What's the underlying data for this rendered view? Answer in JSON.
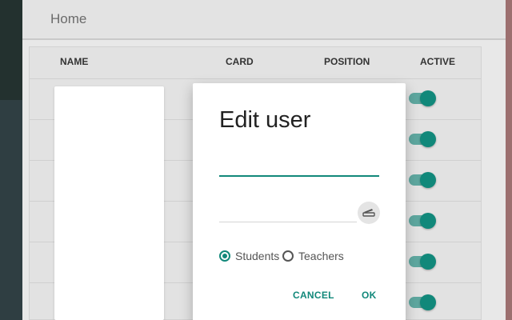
{
  "header": {
    "title": "Home"
  },
  "table": {
    "columns": [
      "NAME",
      "CARD",
      "POSITION",
      "ACTIVE"
    ],
    "rows": [
      {
        "active": true
      },
      {
        "active": true
      },
      {
        "active": true
      },
      {
        "active": true
      },
      {
        "active": true
      },
      {
        "active": true
      }
    ]
  },
  "dialog": {
    "title": "Edit user",
    "name_value": "",
    "card_value": "",
    "role_options": [
      "Students",
      "Teachers"
    ],
    "selected_role": "Students",
    "cancel_label": "CANCEL",
    "ok_label": "OK"
  },
  "colors": {
    "accent": "#11887a",
    "toggle_track": "#5ea79f",
    "sidebar": "#2f3e42"
  },
  "icons": {
    "card_reader": "card-reader-icon"
  }
}
